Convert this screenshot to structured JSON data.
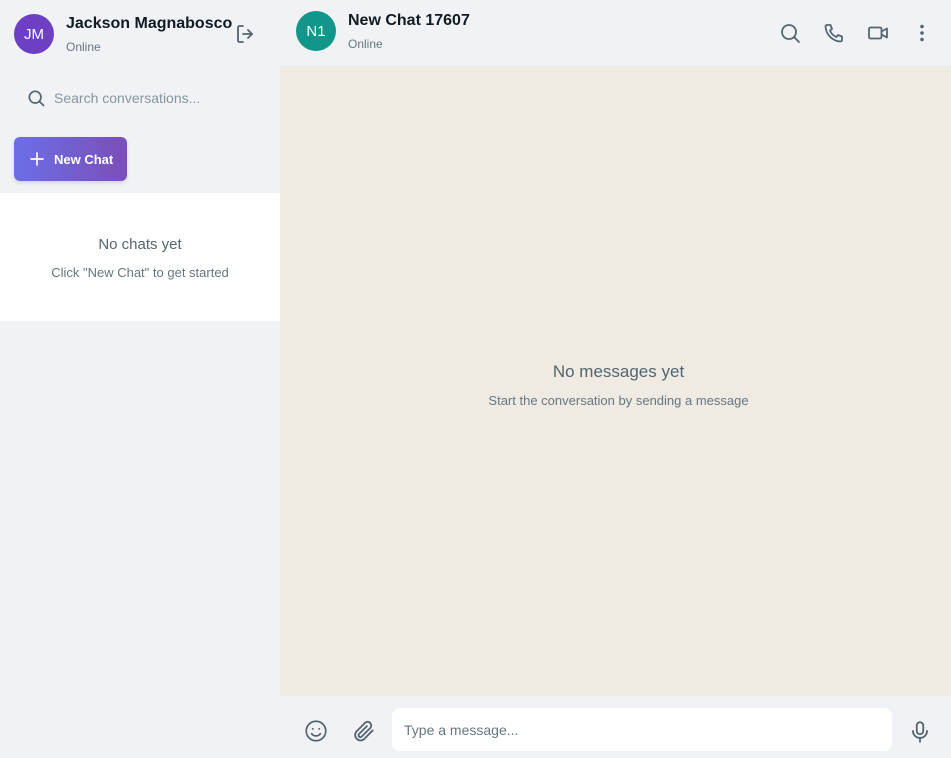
{
  "user": {
    "initials": "JM",
    "name": "Jackson Magnabosco",
    "status": "Online",
    "avatar_color": "#6c3fc4"
  },
  "sidebar": {
    "search_placeholder": "Search conversations...",
    "new_chat_label": "New Chat",
    "empty_title": "No chats yet",
    "empty_subtitle": "Click \"New Chat\" to get started"
  },
  "chat": {
    "initials": "N1",
    "title": "New Chat 17607",
    "status": "Online",
    "avatar_color": "#12968a",
    "empty_title": "No messages yet",
    "empty_subtitle": "Start the conversation by sending a message"
  },
  "composer": {
    "placeholder": "Type a message...",
    "value": ""
  },
  "icons": {
    "logout": "logout-icon",
    "search": "search-icon",
    "new_chat": "plus-icon",
    "header": [
      "search-icon",
      "phone-icon",
      "video-icon",
      "more-vertical-icon"
    ],
    "composer": [
      "emoji-icon",
      "attach-icon",
      "mic-icon"
    ]
  },
  "colors": {
    "accent_gradient_start": "#6c6ee6",
    "accent_gradient_end": "#7a4fb8",
    "chat_background": "#efeae2",
    "panel_background": "#f0f2f5"
  }
}
